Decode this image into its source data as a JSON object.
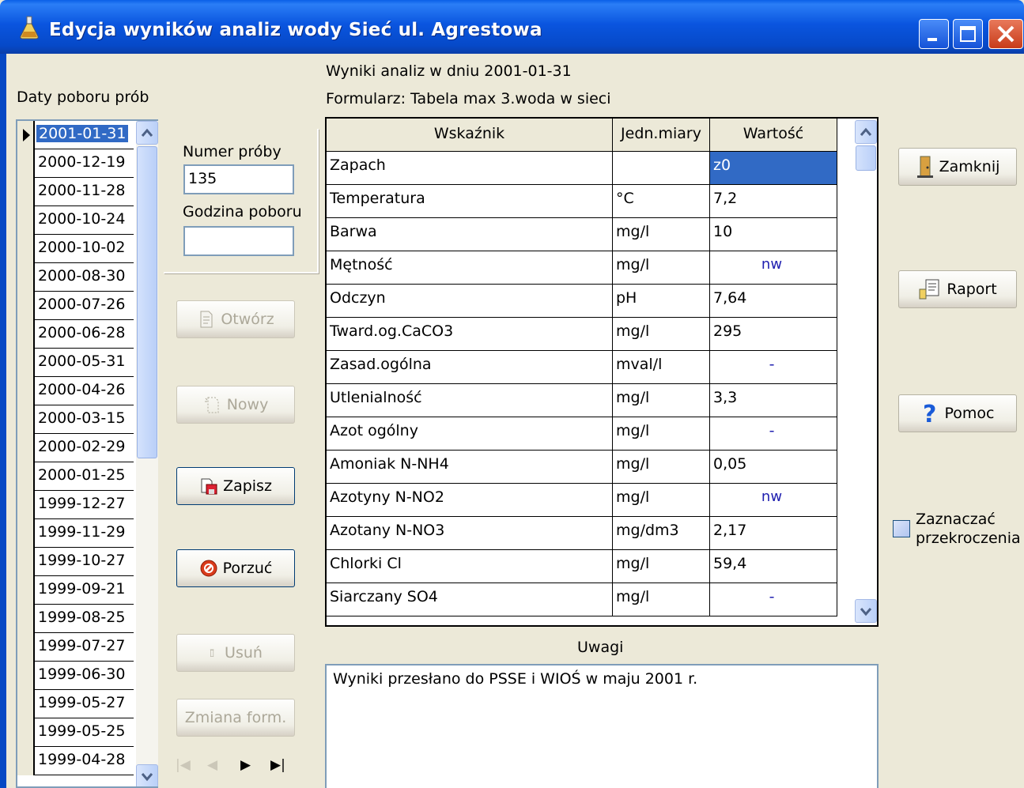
{
  "window": {
    "title": "Edycja wyników analiz wody  Sieć ul. Agrestowa"
  },
  "dates_panel": {
    "label": "Daty poboru prób",
    "dates": [
      "2001-01-31",
      "2000-12-19",
      "2000-11-28",
      "2000-10-24",
      "2000-10-02",
      "2000-08-30",
      "2000-07-26",
      "2000-06-28",
      "2000-05-31",
      "2000-04-26",
      "2000-03-15",
      "2000-02-29",
      "2000-01-25",
      "1999-12-27",
      "1999-11-29",
      "1999-10-27",
      "1999-09-21",
      "1999-08-25",
      "1999-07-27",
      "1999-06-30",
      "1999-05-27",
      "1999-05-25",
      "1999-04-28"
    ],
    "selected_index": 0
  },
  "sample": {
    "number_label": "Numer próby",
    "number_value": "135",
    "time_label": "Godzina poboru",
    "time_value": ""
  },
  "actions": {
    "open": "Otwórz",
    "new": "Nowy",
    "save": "Zapisz",
    "discard": "Porzuć",
    "delete": "Usuń",
    "change_form": "Zmiana form."
  },
  "results": {
    "heading": "Wyniki analiz w dniu 2001-01-31",
    "form": "Formularz: Tabela max 3.woda w sieci",
    "columns": [
      "Wskaźnik",
      "Jedn.miary",
      "Wartość"
    ],
    "rows": [
      {
        "name": "Zapach",
        "unit": "",
        "value": "z0"
      },
      {
        "name": "Temperatura",
        "unit": "°C",
        "value": "7,2"
      },
      {
        "name": "Barwa",
        "unit": "mg/l",
        "value": "10"
      },
      {
        "name": "Mętność",
        "unit": "mg/l",
        "value": "nw"
      },
      {
        "name": "Odczyn",
        "unit": "pH",
        "value": "7,64"
      },
      {
        "name": "Tward.og.CaCO3",
        "unit": "mg/l",
        "value": "295"
      },
      {
        "name": "Zasad.ogólna",
        "unit": "mval/l",
        "value": "-"
      },
      {
        "name": "Utlenialność",
        "unit": "mg/l",
        "value": "3,3"
      },
      {
        "name": "Azot ogólny",
        "unit": "mg/l",
        "value": "-"
      },
      {
        "name": "Amoniak N-NH4",
        "unit": "mg/l",
        "value": "0,05"
      },
      {
        "name": "Azotyny N-NO2",
        "unit": "mg/l",
        "value": "nw"
      },
      {
        "name": "Azotany N-NO3",
        "unit": "mg/dm3",
        "value": "2,17"
      },
      {
        "name": "Chlorki Cl",
        "unit": "mg/l",
        "value": "59,4"
      },
      {
        "name": "Siarczany SO4",
        "unit": "mg/l",
        "value": "-"
      }
    ]
  },
  "notes": {
    "label": "Uwagi",
    "text": "Wyniki przesłano do PSSE i WIOŚ w maju 2001 r."
  },
  "right_panel": {
    "close": "Zamknij",
    "report": "Raport",
    "help": "Pomoc",
    "mark_exceed": "Zaznaczać przekroczenia"
  }
}
